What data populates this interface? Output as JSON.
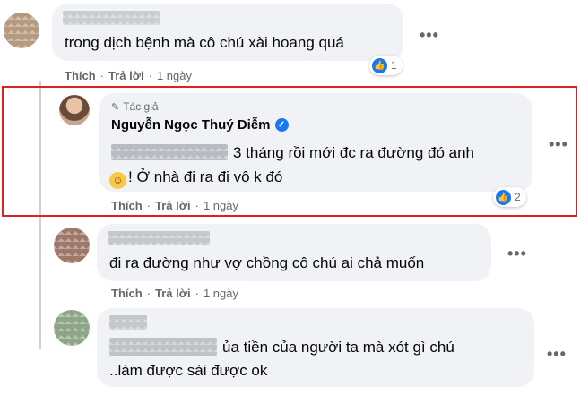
{
  "comments": [
    {
      "text_lines": [
        "trong dịch bệnh mà cô chú xài hoang quá"
      ],
      "like_label": "Thích",
      "reply_label": "Trả lời",
      "time": "1 ngày",
      "reaction_count": "1"
    },
    {
      "author_badge": "Tác giả",
      "author": "Nguyễn Ngọc Thuý Diễm",
      "text_line1": "3 tháng rồi mới đc ra đường đó anh",
      "text_line2": "! Ở nhà đi ra đi vô k đó",
      "like_label": "Thích",
      "reply_label": "Trả lời",
      "time": "1 ngày",
      "reaction_count": "2"
    },
    {
      "text_lines": [
        "đi ra đường như vợ chồng cô chú ai chả muốn"
      ],
      "like_label": "Thích",
      "reply_label": "Trả lời",
      "time": "1 ngày"
    },
    {
      "text_line1": "ủa tiền của người ta mà xót gì chú",
      "text_line2": "..làm được sài được ok"
    }
  ],
  "icons": {
    "more": "more-options-icon",
    "like": "like-icon",
    "verified": "verified-badge-icon",
    "author": "pencil-icon",
    "emoji": "grinning-emoji-icon"
  },
  "colors": {
    "highlight_border": "#e02020",
    "like_blue": "#1877f2",
    "bubble": "#f0f2f5",
    "meta_text": "#65676b"
  }
}
